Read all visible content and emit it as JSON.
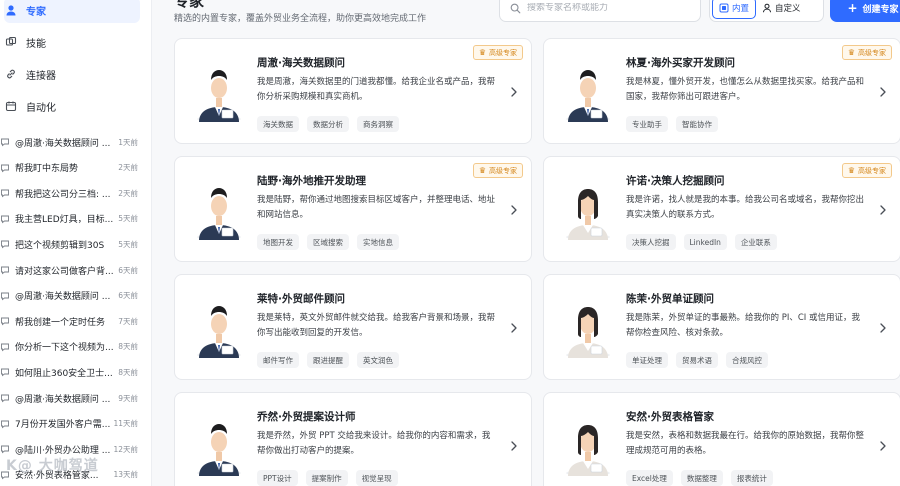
{
  "sidebar": {
    "nav": [
      {
        "label": "专家",
        "icon": "experts-icon",
        "active": true
      },
      {
        "label": "技能",
        "icon": "skills-icon",
        "active": false
      },
      {
        "label": "连接器",
        "icon": "link-icon",
        "active": false
      },
      {
        "label": "自动化",
        "icon": "calendar-icon",
        "active": false
      }
    ],
    "history": [
      {
        "title": "@周澈·海关数据顾问 ...",
        "time": "1天前"
      },
      {
        "title": "帮我盯中东局势",
        "time": "2天前"
      },
      {
        "title": "帮我把这公司分三档: ...",
        "time": "2天前"
      },
      {
        "title": "我主营LED灯具，目标...",
        "time": "5天前"
      },
      {
        "title": "把这个视频剪辑到30S",
        "time": "5天前"
      },
      {
        "title": "请对这家公司做客户背...",
        "time": "6天前"
      },
      {
        "title": "@周澈·海关数据顾问 ...",
        "time": "6天前"
      },
      {
        "title": "帮我创建一个定时任务",
        "time": "7天前"
      },
      {
        "title": "你分析一下这个视频为...",
        "time": "8天前"
      },
      {
        "title": "如何阻止360安全卫士...",
        "time": "8天前"
      },
      {
        "title": "@周澈·海关数据顾问 ...",
        "time": "9天前"
      },
      {
        "title": "7月份开发国外客户需...",
        "time": "11天前"
      },
      {
        "title": "@陆川·外贸办公助理 ...",
        "time": "12天前"
      },
      {
        "title": "安然·外贸表格管家...",
        "time": "13天前"
      }
    ],
    "watermark": "K@ 大咖驾道"
  },
  "header": {
    "title": "专家",
    "subtitle": "精选的内置专家，覆盖外贸业务全流程，助你更高效地完成工作",
    "search_placeholder": "搜索专家名称或能力",
    "seg_builtin": "内置",
    "seg_custom": "自定义",
    "create_label": "创建专家"
  },
  "badge_label": "高级专家",
  "colors": {
    "accent": "#2f6bff",
    "badge": "#d4861a"
  },
  "cards": [
    {
      "name": "周澈·海关数据顾问",
      "desc": "我是周澈，海关数据里的门道我都懂。给我企业名或产品，我帮你分析采购规模和真实商机。",
      "tags": [
        "海关数据",
        "数据分析",
        "商务洞察"
      ],
      "badge": true,
      "gender": "m"
    },
    {
      "name": "林夏·海外买家开发顾问",
      "desc": "我是林夏，懂外贸开发，也懂怎么从数据里找买家。给我产品和国家，我帮你筛出可跟进客户。",
      "tags": [
        "专业助手",
        "智能协作"
      ],
      "badge": true,
      "gender": "m"
    },
    {
      "name": "陆野·海外地推开发助理",
      "desc": "我是陆野，帮你通过地图搜索目标区域客户，并整理电话、地址和网站信息。",
      "tags": [
        "地图开发",
        "区域搜索",
        "实地信息"
      ],
      "badge": true,
      "gender": "m"
    },
    {
      "name": "许诺·决策人挖掘顾问",
      "desc": "我是许诺，找人就是我的本事。给我公司名或域名，我帮你挖出真实决策人的联系方式。",
      "tags": [
        "决策人挖掘",
        "LinkedIn",
        "企业联系"
      ],
      "badge": true,
      "gender": "f"
    },
    {
      "name": "莱特·外贸邮件顾问",
      "desc": "我是莱特，英文外贸邮件就交给我。给我客户背景和场景，我帮你写出能收到回复的开发信。",
      "tags": [
        "邮件写作",
        "跟进提醒",
        "英文润色"
      ],
      "badge": false,
      "gender": "m"
    },
    {
      "name": "陈茉·外贸单证顾问",
      "desc": "我是陈茉，外贸单证的事最熟。给我你的 PI、CI 或信用证，我帮你检查风险、核对条款。",
      "tags": [
        "单证处理",
        "贸易术语",
        "合规风控"
      ],
      "badge": false,
      "gender": "f"
    },
    {
      "name": "乔然·外贸提案设计师",
      "desc": "我是乔然，外贸 PPT 交给我来设计。给我你的内容和需求，我帮你做出打动客户的提案。",
      "tags": [
        "PPT设计",
        "提案制作",
        "视觉呈现"
      ],
      "badge": false,
      "gender": "m"
    },
    {
      "name": "安然·外贸表格管家",
      "desc": "我是安然，表格和数据我最在行。给我你的原始数据，我帮你整理成规范可用的表格。",
      "tags": [
        "Excel处理",
        "数据整理",
        "报表统计"
      ],
      "badge": false,
      "gender": "f"
    }
  ]
}
